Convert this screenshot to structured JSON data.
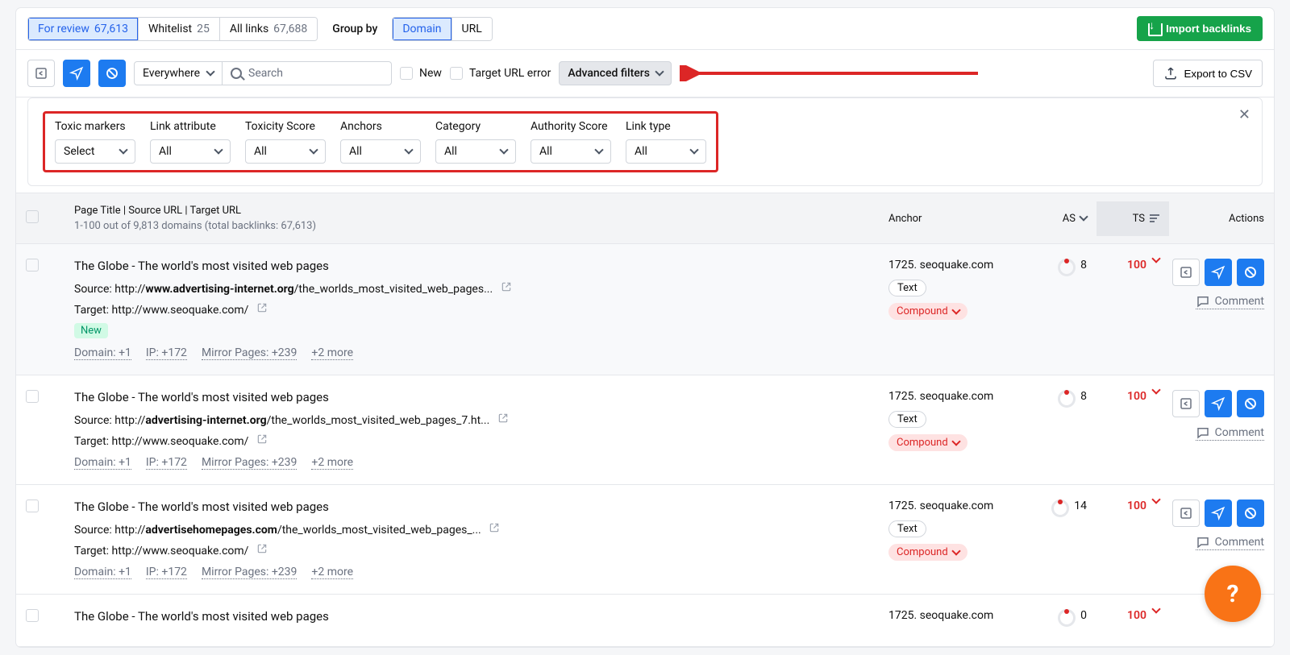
{
  "tabs": {
    "for_review": {
      "label": "For review",
      "count": "67,613"
    },
    "whitelist": {
      "label": "Whitelist",
      "count": "25"
    },
    "all_links": {
      "label": "All links",
      "count": "67,688"
    }
  },
  "group_by": {
    "label": "Group by",
    "domain": "Domain",
    "url": "URL"
  },
  "import_btn": "Import backlinks",
  "toolbar": {
    "scope": "Everywhere",
    "search_placeholder": "Search",
    "new": "New",
    "url_error": "Target URL error",
    "advanced": "Advanced filters",
    "export": "Export to CSV"
  },
  "filters": [
    {
      "label": "Toxic markers",
      "value": "Select"
    },
    {
      "label": "Link attribute",
      "value": "All"
    },
    {
      "label": "Toxicity Score",
      "value": "All"
    },
    {
      "label": "Anchors",
      "value": "All"
    },
    {
      "label": "Category",
      "value": "All"
    },
    {
      "label": "Authority Score",
      "value": "All"
    },
    {
      "label": "Link type",
      "value": "All"
    }
  ],
  "thead": {
    "title": "Page Title | Source URL | Target URL",
    "sub": "1-100 out of 9,813 domains (total backlinks: 67,613)",
    "anchor": "Anchor",
    "as": "AS",
    "ts": "TS",
    "actions": "Actions"
  },
  "badges": {
    "new": "New",
    "text": "Text",
    "compound": "Compound"
  },
  "static": {
    "source": "Source:",
    "target": "Target:",
    "comment": "Comment"
  },
  "rows": [
    {
      "title": "The Globe - The world's most visited web pages",
      "source_pre": "http://",
      "source_bold": "www.advertising-internet.org",
      "source_rest": "/the_worlds_most_visited_web_pages...",
      "target": "http://www.seoquake.com/",
      "is_new": true,
      "stats": [
        "Domain: +1",
        "IP: +172",
        "Mirror Pages: +239",
        "+2 more"
      ],
      "anchor": "1725. seoquake.com",
      "as": "8",
      "ts": "100"
    },
    {
      "title": "The Globe - The world's most visited web pages",
      "source_pre": "http://",
      "source_bold": "advertising-internet.org",
      "source_rest": "/the_worlds_most_visited_web_pages_7.ht...",
      "target": "http://www.seoquake.com/",
      "is_new": false,
      "stats": [
        "Domain: +1",
        "IP: +172",
        "Mirror Pages: +239",
        "+2 more"
      ],
      "anchor": "1725. seoquake.com",
      "as": "8",
      "ts": "100"
    },
    {
      "title": "The Globe - The world's most visited web pages",
      "source_pre": "http://",
      "source_bold": "advertisehomepages.com",
      "source_rest": "/the_worlds_most_visited_web_pages_...",
      "target": "http://www.seoquake.com/",
      "is_new": false,
      "stats": [
        "Domain: +1",
        "IP: +172",
        "Mirror Pages: +239",
        "+2 more"
      ],
      "anchor": "1725. seoquake.com",
      "as": "14",
      "ts": "100"
    },
    {
      "title": "The Globe - The world's most visited web pages",
      "source_pre": "",
      "source_bold": "",
      "source_rest": "",
      "target": "",
      "is_new": false,
      "stats": [],
      "anchor": "1725. seoquake.com",
      "as": "0",
      "ts": "100"
    }
  ]
}
